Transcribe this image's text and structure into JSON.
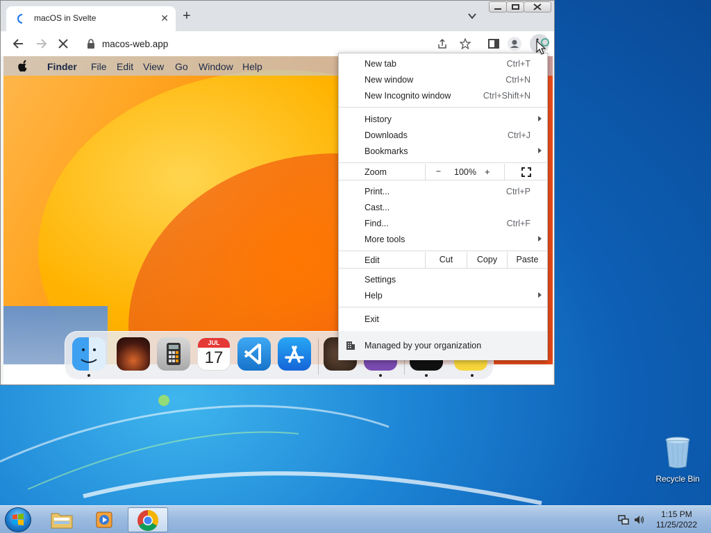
{
  "browser": {
    "tab_title": "macOS in Svelte",
    "new_tab_symbol": "+",
    "close_symbol": "✕",
    "url": "macos-web.app"
  },
  "mac": {
    "menubar": [
      "Finder",
      "File",
      "Edit",
      "View",
      "Go",
      "Window",
      "Help"
    ],
    "calendar_month": "JUL",
    "calendar_day": "17"
  },
  "menu": {
    "new_tab": {
      "label": "New tab",
      "shortcut": "Ctrl+T"
    },
    "new_window": {
      "label": "New window",
      "shortcut": "Ctrl+N"
    },
    "new_incognito": {
      "label": "New Incognito window",
      "shortcut": "Ctrl+Shift+N"
    },
    "history": {
      "label": "History"
    },
    "downloads": {
      "label": "Downloads",
      "shortcut": "Ctrl+J"
    },
    "bookmarks": {
      "label": "Bookmarks"
    },
    "zoom": {
      "label": "Zoom",
      "minus": "−",
      "value": "100%",
      "plus": "+"
    },
    "print": {
      "label": "Print...",
      "shortcut": "Ctrl+P"
    },
    "cast": {
      "label": "Cast..."
    },
    "find": {
      "label": "Find...",
      "shortcut": "Ctrl+F"
    },
    "more_tools": {
      "label": "More tools"
    },
    "edit": {
      "label": "Edit",
      "cut": "Cut",
      "copy": "Copy",
      "paste": "Paste"
    },
    "settings": {
      "label": "Settings"
    },
    "help": {
      "label": "Help"
    },
    "exit": {
      "label": "Exit"
    },
    "managed": {
      "label": "Managed by your organization"
    }
  },
  "desktop": {
    "recycle_bin": "Recycle Bin"
  },
  "taskbar": {
    "time": "1:15 PM",
    "date": "11/25/2022"
  }
}
